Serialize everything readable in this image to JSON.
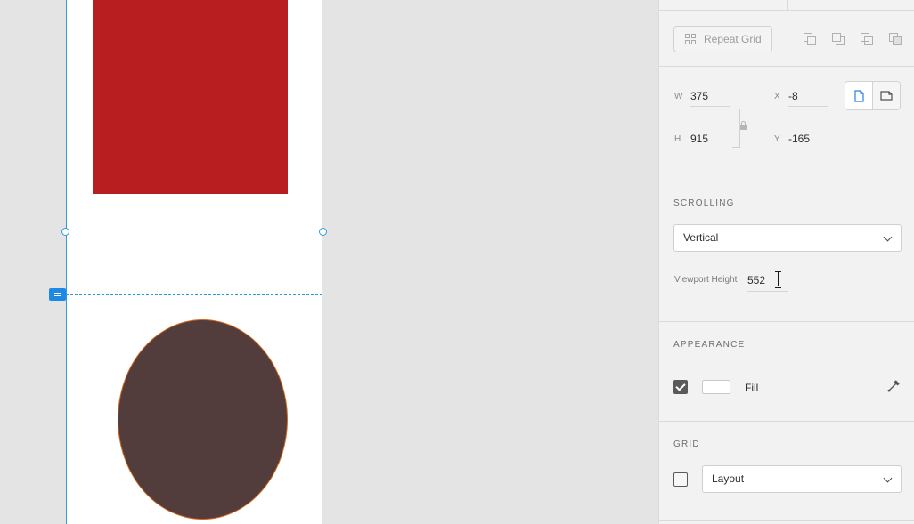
{
  "inspector": {
    "repeat_grid_label": "Repeat Grid",
    "dimensions": {
      "w_label": "W",
      "w_value": "375",
      "x_label": "X",
      "x_value": "-8",
      "h_label": "H",
      "h_value": "915",
      "y_label": "Y",
      "y_value": "-165"
    },
    "scrolling": {
      "title": "SCROLLING",
      "mode": "Vertical",
      "viewport_height_label": "Viewport Height",
      "viewport_height_value": "552"
    },
    "appearance": {
      "title": "APPEARANCE",
      "fill_label": "Fill",
      "fill_enabled": true,
      "fill_color": "#ffffff"
    },
    "grid": {
      "title": "GRID",
      "enabled": false,
      "type": "Layout"
    }
  },
  "colors": {
    "rectangle": "#b81e1f",
    "ellipse": "#533c3c",
    "selection": "#2d9cdb",
    "accent": "#1e88e5"
  },
  "icons": [
    "repeat-grid-icon",
    "add-icon",
    "subtract-icon",
    "intersect-icon",
    "exclude-icon",
    "lock-icon",
    "portrait-icon",
    "landscape-icon",
    "chevron-down-icon",
    "eyedropper-icon",
    "text-cursor-icon",
    "viewport-marker-icon"
  ]
}
